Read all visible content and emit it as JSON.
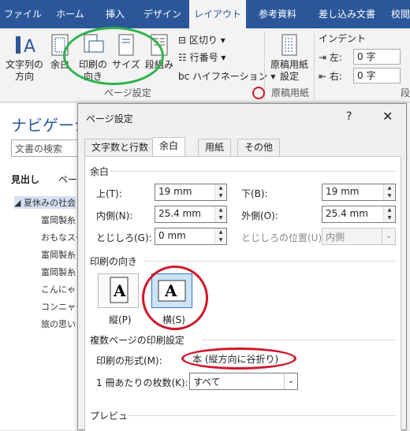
{
  "ribbon_tabs": [
    "ファイル",
    "ホーム",
    "挿入",
    "デザイン",
    "レイアウト",
    "参考資料",
    "差し込み文書",
    "校閲"
  ],
  "active_tab": "レイアウト",
  "ribbon": {
    "btn_margins_dir": "文字列の\n方向",
    "btn_margins": "余白",
    "btn_orientation": "印刷の\n向き",
    "btn_size": "サイズ",
    "btn_columns": "段組み",
    "breaks": "区切り",
    "line_numbers": "行番号",
    "hyphenation": "ハイフネーション",
    "group_page_setup": "ページ設定",
    "genko_btn": "原稿用紙\n設定",
    "group_genko": "原稿用紙",
    "indent_title": "インデント",
    "indent_left_label": "左:",
    "indent_left_value": "0 字",
    "indent_right_label": "右:",
    "indent_right_value": "0 字",
    "group_paragraph": "段"
  },
  "nav": {
    "title": "ナビゲーショ",
    "search_placeholder": "文書の検索",
    "tab_headings": "見出し",
    "tab_pages": "ペー",
    "items": [
      "夏休みの社会",
      "富岡製糸",
      "おもなスケ",
      "富岡製糸",
      "富岡製糸",
      "こんにゃく",
      "コンニャク",
      "旅の思い"
    ]
  },
  "dialog": {
    "title": "ページ設定",
    "help": "?",
    "close": "✕",
    "tabs": [
      "文字数と行数",
      "余白",
      "用紙",
      "その他"
    ],
    "active_tab": "余白",
    "margins_section": "余白",
    "top_label": "上(T):",
    "top_value": "19 mm",
    "bottom_label": "下(B):",
    "bottom_value": "19 mm",
    "inside_label": "内側(N):",
    "inside_value": "25.4 mm",
    "outside_label": "外側(O):",
    "outside_value": "25.4 mm",
    "gutter_label": "とじしろ(G):",
    "gutter_value": "0 mm",
    "gutter_pos_label": "とじしろの位置(U):",
    "gutter_pos_value": "内側",
    "orientation_section": "印刷の向き",
    "portrait_label": "縦(P)",
    "landscape_label": "横(S)",
    "pages_section": "複数ページの印刷設定",
    "multi_label": "印刷の形式(M):",
    "multi_value": "本 (縦方向に谷折り)",
    "sheets_label": "1 冊あたりの枚数(K):",
    "sheets_value": "すべて",
    "preview_section": "プレビュー"
  },
  "colors": {
    "ribbon_blue": "#2b579a",
    "annotation_green": "#2eb24a",
    "annotation_red": "#d0182a"
  }
}
